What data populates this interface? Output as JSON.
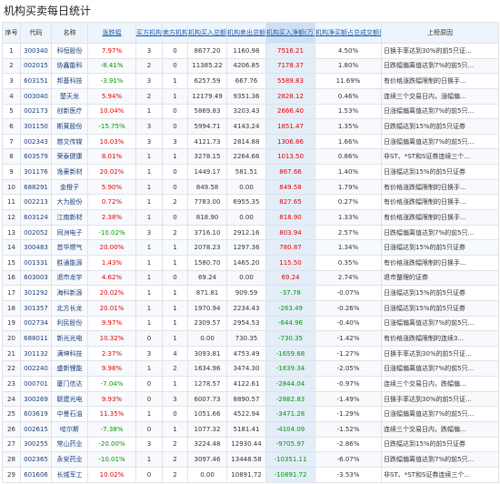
{
  "title": "机构买卖每日统计",
  "headers": [
    "序号",
    "代码",
    "名称",
    "涨跌幅",
    "买方机构数",
    "卖方机构数",
    "机构买入总额(万)",
    "机构卖出总额(万)",
    "机构买入净额(万)",
    "机构净买额占总成交额比",
    "上榜原因"
  ],
  "rows": [
    [
      "1",
      "300340",
      "科恒股份",
      "7.97%",
      "3",
      "0",
      "8677.20",
      "1160.98",
      "7516.21",
      "4.50%",
      "日换手率达到30%的前5只证..."
    ],
    [
      "2",
      "002015",
      "协鑫能科",
      "-8.41%",
      "2",
      "0",
      "11385.22",
      "4206.85",
      "7178.37",
      "1.80%",
      "日跌幅偏离值达到7%的前5只..."
    ],
    [
      "3",
      "603151",
      "邦基科技",
      "-3.91%",
      "3",
      "1",
      "6257.59",
      "667.76",
      "5589.83",
      "11.69%",
      "有价格涨跌幅限制的日换手..."
    ],
    [
      "4",
      "003040",
      "楚天龙",
      "5.94%",
      "2",
      "1",
      "12179.49",
      "9351.36",
      "2828.12",
      "0.46%",
      "连续三个交易日内，涨幅偏..."
    ],
    [
      "5",
      "002173",
      "创新医疗",
      "10.04%",
      "1",
      "0",
      "5869.83",
      "3203.43",
      "2666.40",
      "1.53%",
      "日涨幅偏离值达到7%的前5只..."
    ],
    [
      "6",
      "301150",
      "斯莱股份",
      "-15.75%",
      "3",
      "0",
      "5994.71",
      "4143.24",
      "1851.47",
      "1.35%",
      "日跌幅达到15%的前5只证券"
    ],
    [
      "7",
      "002343",
      "慈文传媒",
      "10.03%",
      "3",
      "3",
      "4121.73",
      "2814.88",
      "1306.86",
      "1.66%",
      "日涨幅偏离值达到7%的前5只..."
    ],
    [
      "8",
      "603579",
      "荣泰健康",
      "8.01%",
      "1",
      "1",
      "3278.15",
      "2264.66",
      "1013.50",
      "0.86%",
      "非ST、*ST和S证券连续三个..."
    ],
    [
      "9",
      "301176",
      "逸豪新材",
      "20.02%",
      "1",
      "0",
      "1449.17",
      "581.51",
      "867.66",
      "1.40%",
      "日涨幅达到15%的前5只证券"
    ],
    [
      "10",
      "688291",
      "金橙子",
      "5.90%",
      "1",
      "0",
      "849.58",
      "0.00",
      "849.58",
      "1.79%",
      "有价格涨跌幅限制的日换手..."
    ],
    [
      "11",
      "002213",
      "大为股份",
      "0.72%",
      "1",
      "2",
      "7783.00",
      "6955.35",
      "827.65",
      "0.27%",
      "有价格涨跌幅限制的日换手..."
    ],
    [
      "12",
      "603124",
      "江南新材",
      "2.38%",
      "1",
      "0",
      "818.90",
      "0.00",
      "818.90",
      "1.33%",
      "有价格涨跌幅限制的日换手..."
    ],
    [
      "13",
      "002052",
      "同洲电子",
      "-10.02%",
      "3",
      "2",
      "3716.10",
      "2912.16",
      "803.94",
      "2.57%",
      "日跌幅偏离值达到7%的前5只..."
    ],
    [
      "14",
      "300483",
      "首华燃气",
      "20.00%",
      "1",
      "1",
      "2078.23",
      "1297.36",
      "780.87",
      "1.34%",
      "日涨幅达到15%的前5只证券"
    ],
    [
      "15",
      "001331",
      "胜通能源",
      "1.43%",
      "1",
      "1",
      "1580.70",
      "1465.20",
      "115.50",
      "0.35%",
      "有价格涨跌幅限制的日换手..."
    ],
    [
      "16",
      "603003",
      "退市龙宇",
      "4.62%",
      "1",
      "0",
      "69.24",
      "0.00",
      "69.24",
      "2.74%",
      "退市整理的证券"
    ],
    [
      "17",
      "301292",
      "海科新源",
      "20.02%",
      "1",
      "1",
      "871.81",
      "909.59",
      "-37.78",
      "-0.07%",
      "日涨幅达到15%的前5只证券"
    ],
    [
      "18",
      "301357",
      "北方长龙",
      "20.01%",
      "1",
      "1",
      "1970.94",
      "2234.43",
      "-263.49",
      "-0.26%",
      "日涨幅达到15%的前5只证券"
    ],
    [
      "19",
      "002734",
      "利民股份",
      "9.97%",
      "1",
      "1",
      "2309.57",
      "2954.53",
      "-644.96",
      "-0.40%",
      "日涨幅偏离值达到7%的前5只..."
    ],
    [
      "20",
      "688011",
      "新光光电",
      "10.32%",
      "0",
      "1",
      "0.00",
      "730.35",
      "-730.35",
      "-1.42%",
      "有价格涨跌幅限制的连续3..."
    ],
    [
      "21",
      "301132",
      "满坤科技",
      "2.37%",
      "3",
      "4",
      "3093.81",
      "4753.49",
      "-1659.68",
      "-1.27%",
      "日换手率达到30%的前5只证..."
    ],
    [
      "22",
      "002240",
      "盛新锂能",
      "9.98%",
      "1",
      "2",
      "1634.96",
      "3474.30",
      "-1839.34",
      "-2.05%",
      "日涨幅偏离值达到7%的前5只..."
    ],
    [
      "23",
      "000701",
      "厦门信达",
      "-7.04%",
      "0",
      "1",
      "1278.57",
      "4122.61",
      "-2844.04",
      "-0.97%",
      "连续三个交易日内，跌幅偏..."
    ],
    [
      "24",
      "300269",
      "联建光电",
      "9.93%",
      "0",
      "3",
      "6007.73",
      "8890.57",
      "-2882.83",
      "-1.49%",
      "日换手率达到30%的前5只证..."
    ],
    [
      "25",
      "603619",
      "中曼石油",
      "11.35%",
      "1",
      "0",
      "1051.66",
      "4522.94",
      "-3471.28",
      "-1.29%",
      "日涨幅偏离值达到7%的前5只..."
    ],
    [
      "26",
      "002615",
      "哈尔斯",
      "-7.38%",
      "0",
      "1",
      "1077.32",
      "5181.41",
      "-4104.09",
      "-1.52%",
      "连续三个交易日内，跌幅偏..."
    ],
    [
      "27",
      "300255",
      "常山药业",
      "-20.00%",
      "3",
      "2",
      "3224.48",
      "12930.44",
      "-9705.97",
      "-2.86%",
      "日跌幅达到15%的前5只证券"
    ],
    [
      "28",
      "002365",
      "永安药业",
      "-10.01%",
      "1",
      "2",
      "3097.46",
      "13448.58",
      "-10351.11",
      "-6.07%",
      "日跌幅偏离值达到7%的前5只..."
    ],
    [
      "29",
      "601606",
      "长城军工",
      "10.02%",
      "0",
      "2",
      "0.00",
      "10891.72",
      "-10891.72",
      "-3.53%",
      "非ST、*ST和S证券连续三个..."
    ]
  ],
  "colors": {
    "up": "#e60000",
    "down": "#009900",
    "header_bg": "#eef4fb",
    "header_hl": "#cfe0f4"
  },
  "sort_icon": "sort-arrows-icon"
}
